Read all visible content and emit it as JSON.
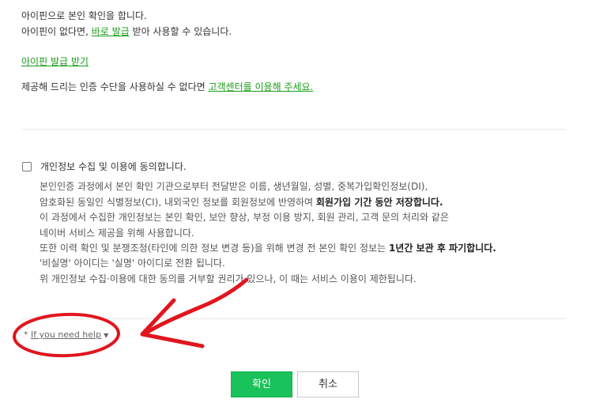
{
  "intro": {
    "line1": "아이핀으로 본인 확인을 합니다.",
    "line2_before": "아이핀이 없다면, ",
    "line2_link": "바로 발급",
    "line2_after": " 받아 사용할 수 있습니다."
  },
  "ipin_issue_link": "아이핀 발급 받기",
  "support": {
    "before": "제공해 드리는 인증 수단을 사용하실 수 없다면 ",
    "link": "고객센터를 이용해 주세요."
  },
  "consent": {
    "checked": false,
    "label": "개인정보 수집 및 이용에 동의합니다.",
    "p1": "본인인증 과정에서 본인 확인 기관으로부터 전달받은 이름, 생년월일, 성별, 중복가입확인정보(DI),",
    "p2_normal": "암호화된 동일인 식별정보(CI), 내외국인 정보를 회원정보에 반영하여 ",
    "p2_bold": "회원가입 기간 동안 저장합니다.",
    "p3": "이 과정에서 수집한 개인정보는 본인 확인, 보안 향상, 부정 이용 방지, 회원 관리, 고객 문의 처리와 같은",
    "p4": "네이버 서비스 제공을 위해 사용합니다.",
    "p5_normal": "또한 이력 확인 및 분쟁조정(타인에 의한 정보 변경 등)을 위해 변경 전 본인 확인 정보는 ",
    "p5_bold": "1년간 보관 후 파기합니다.",
    "p6": "'비실명' 아이디는 '실명' 아이디로 전환 됩니다.",
    "p7": "위 개인정보 수집·이용에 대한 동의를 거부할 권리가 있으나, 이 때는 서비스 이용이 제한됩니다."
  },
  "help": {
    "prefix": "*",
    "label": "If you need help",
    "caret": "▼"
  },
  "buttons": {
    "confirm": "확인",
    "cancel": "취소"
  },
  "colors": {
    "link": "#1a9e1a",
    "confirm_bg": "#19c25a",
    "annotation": "#e0161e"
  }
}
